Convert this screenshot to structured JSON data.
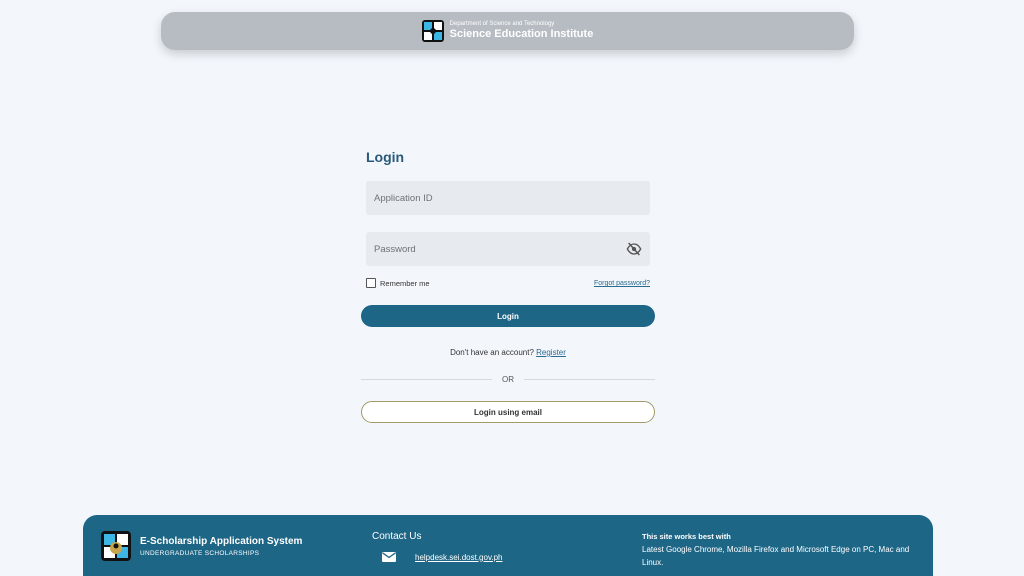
{
  "header": {
    "org_sub": "Department of Science and Technology",
    "org_main": "Science Education Institute"
  },
  "login": {
    "title": "Login",
    "appid_placeholder": "Application ID",
    "password_placeholder": "Password",
    "remember_label": "Remember me",
    "forgot_label": "Forgot password?",
    "login_button": "Login",
    "no_account_text": "Don't have an account?",
    "register_link": "Register",
    "or_text": "OR",
    "email_button": "Login using email"
  },
  "footer": {
    "system_title": "E-Scholarship Application System",
    "system_sub": "UNDERGRADUATE SCHOLARSHIPS",
    "contact_title": "Contact Us",
    "contact_email": "helpdesk.sei.dost.gov.ph",
    "works_title": "This site works best with",
    "works_body": "Latest Google Chrome, Mozilla Firefox and Microsoft Edge on PC, Mac and Linux."
  },
  "colors": {
    "primary": "#1e6686",
    "header_bar": "#b7bcc3",
    "background": "#f3f7fc",
    "email_button_border": "#a39a6a"
  },
  "icons": [
    "dost-logo-icon",
    "eye-slash-icon",
    "mail-icon",
    "sei-logo-icon"
  ]
}
